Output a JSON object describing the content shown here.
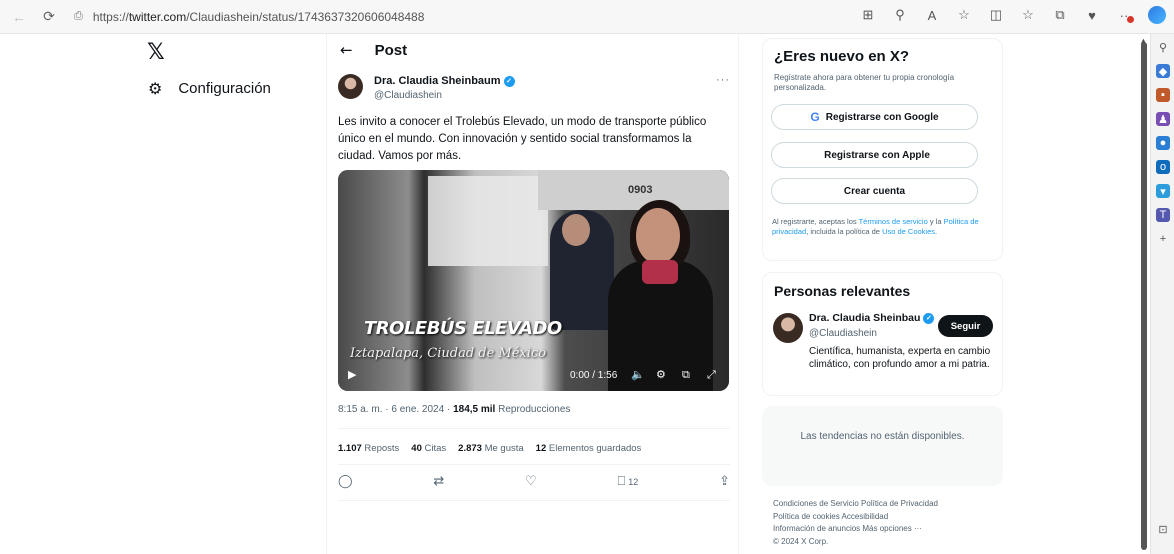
{
  "browser": {
    "url_prefix": "https://",
    "url_domain": "twitter.com",
    "url_path": "/Claudiashein/status/1743637320606048488"
  },
  "left_nav": {
    "logo": "𝕏",
    "settings_label": "Configuración"
  },
  "post": {
    "header_title": "Post",
    "author_name": "Dra. Claudia Sheinbaum",
    "author_handle": "@Claudiashein",
    "text": "Les invito a conocer el Trolebús Elevado, un modo de transporte público único en el mundo. Con innovación y sentido social transformamos la ciudad. Vamos por más.",
    "video": {
      "title": "TROLEBÚS ELEVADO",
      "subtitle": "Iztapalapa, Ciudad de México",
      "overlay_text": "0903",
      "time": "0:00 / 1:56"
    },
    "meta_time": "8:15 a. m. · 6 ene. 2024 · ",
    "meta_views": "184,5 mil",
    "meta_views_label": " Reproducciones",
    "stats": [
      {
        "value": "1.107",
        "label": " Reposts"
      },
      {
        "value": "40",
        "label": " Citas"
      },
      {
        "value": "2.873",
        "label": " Me gusta"
      },
      {
        "value": "12",
        "label": " Elementos guardados"
      }
    ],
    "bookmark_count": "12"
  },
  "signup": {
    "title": "¿Eres nuevo en X?",
    "subtitle": "Regístrate ahora para obtener tu propia cronología personalizada.",
    "google_label": "Registrarse con Google",
    "apple_label": "Registrarse con Apple",
    "create_label": "Crear cuenta",
    "terms_1": "Al registrarte, aceptas los ",
    "terms_link1": "Términos de servicio",
    "terms_2": " y la ",
    "terms_link2": "Política de privacidad",
    "terms_3": ", incluida la política de ",
    "terms_link3": "Uso de Cookies",
    "terms_4": "."
  },
  "people": {
    "title": "Personas relevantes",
    "name": "Dra. Claudia Sheinbau",
    "handle": "@Claudiashein",
    "bio": "Científica, humanista, experta en cambio climático, con profundo amor a mi patria.",
    "follow_label": "Seguir"
  },
  "trends": {
    "text": "Las tendencias no están disponibles."
  },
  "footer": {
    "line1": "Condiciones de Servicio   Política de Privacidad",
    "line2": "Política de cookies   Accesibilidad",
    "line3": "Información de anuncios   Más opciones ···",
    "line4": "© 2024 X Corp."
  },
  "colors": {
    "accent": "#1d9bf0",
    "text": "#0f1419",
    "muted": "#536471"
  }
}
